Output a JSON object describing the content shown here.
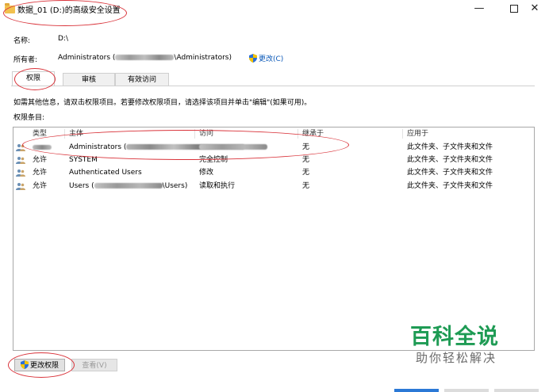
{
  "window": {
    "title": "数据_01 (D:)的高级安全设置",
    "controls": {
      "minimize": "—",
      "close": "✕"
    }
  },
  "info": {
    "name_label": "名称:",
    "name_value": "D:\\",
    "owner_label": "所有者:",
    "owner_prefix": "Administrators (",
    "owner_suffix": "\\Administrators)",
    "change_link": "更改(C)"
  },
  "tabs": [
    {
      "label": "权限",
      "active": true
    },
    {
      "label": "审核",
      "active": false
    },
    {
      "label": "有效访问",
      "active": false
    }
  ],
  "instructions": "如需其他信息，请双击权限项目。若要修改权限项目，请选择该项目并单击\"编辑\"(如果可用)。",
  "entries_label": "权限条目:",
  "table": {
    "headers": [
      "类型",
      "主体",
      "访问",
      "继承于",
      "应用于"
    ],
    "rows": [
      {
        "type": "",
        "principal_prefix": "Administrators (",
        "principal_suffix": "",
        "access": "",
        "inherited": "无",
        "applies": "此文件夹、子文件夹和文件"
      },
      {
        "type": "允许",
        "principal_prefix": "SYSTEM",
        "principal_suffix": "",
        "access": "完全控制",
        "inherited": "无",
        "applies": "此文件夹、子文件夹和文件"
      },
      {
        "type": "允许",
        "principal_prefix": "Authenticated Users",
        "principal_suffix": "",
        "access": "修改",
        "inherited": "无",
        "applies": "此文件夹、子文件夹和文件"
      },
      {
        "type": "允许",
        "principal_prefix": "Users (",
        "principal_suffix": "\\Users)",
        "access": "读取和执行",
        "inherited": "无",
        "applies": "此文件夹、子文件夹和文件"
      }
    ]
  },
  "buttons": {
    "change_permissions": "更改权限",
    "view": "查看(V)"
  },
  "watermark": {
    "main": "百科全说",
    "sub": "助你轻松解决"
  },
  "colors": {
    "link": "#0a58b8",
    "annotation": "#d9333a",
    "watermark": "#1e9b54"
  }
}
